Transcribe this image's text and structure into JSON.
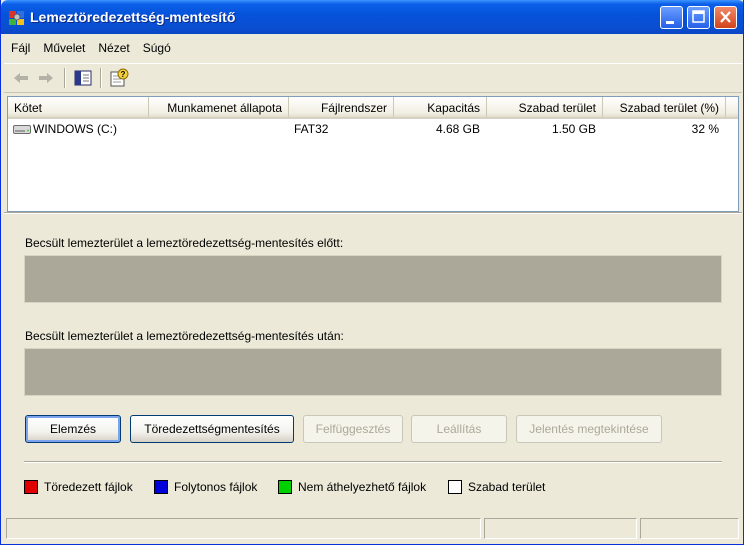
{
  "window": {
    "title": "Lemeztöredezettség-mentesítő"
  },
  "menu": [
    "Fájl",
    "Művelet",
    "Nézet",
    "Súgó"
  ],
  "list": {
    "columns": [
      "Kötet",
      "Munkamenet állapota",
      "Fájlrendszer",
      "Kapacitás",
      "Szabad terület",
      "Szabad terület (%)"
    ],
    "rows": [
      {
        "volume": "WINDOWS (C:)",
        "session": "",
        "filesystem": "FAT32",
        "capacity": "4.68 GB",
        "free": "1.50 GB",
        "free_pct": "32 %"
      }
    ]
  },
  "estimate_before_label": "Becsült lemezterület a lemeztöredezettség-mentesítés előtt:",
  "estimate_after_label": "Becsült lemezterület a lemeztöredezettség-mentesítés után:",
  "buttons": {
    "analyze": "Elemzés",
    "defragment": "Töredezettségmentesítés",
    "pause": "Felfüggesztés",
    "stop": "Leállítás",
    "view_report": "Jelentés megtekintése"
  },
  "legend": [
    {
      "label": "Töredezett fájlok",
      "color": "#e00000"
    },
    {
      "label": "Folytonos fájlok",
      "color": "#0000d8"
    },
    {
      "label": "Nem áthelyezhető fájlok",
      "color": "#00d000"
    },
    {
      "label": "Szabad terület",
      "color": "#ffffff"
    }
  ],
  "icons": {
    "app": "defrag-app-icon",
    "back": "back-arrow-icon",
    "forward": "forward-arrow-icon",
    "show_hide_tree": "console-tree-icon",
    "help": "help-icon",
    "drive": "hard-drive-icon"
  }
}
